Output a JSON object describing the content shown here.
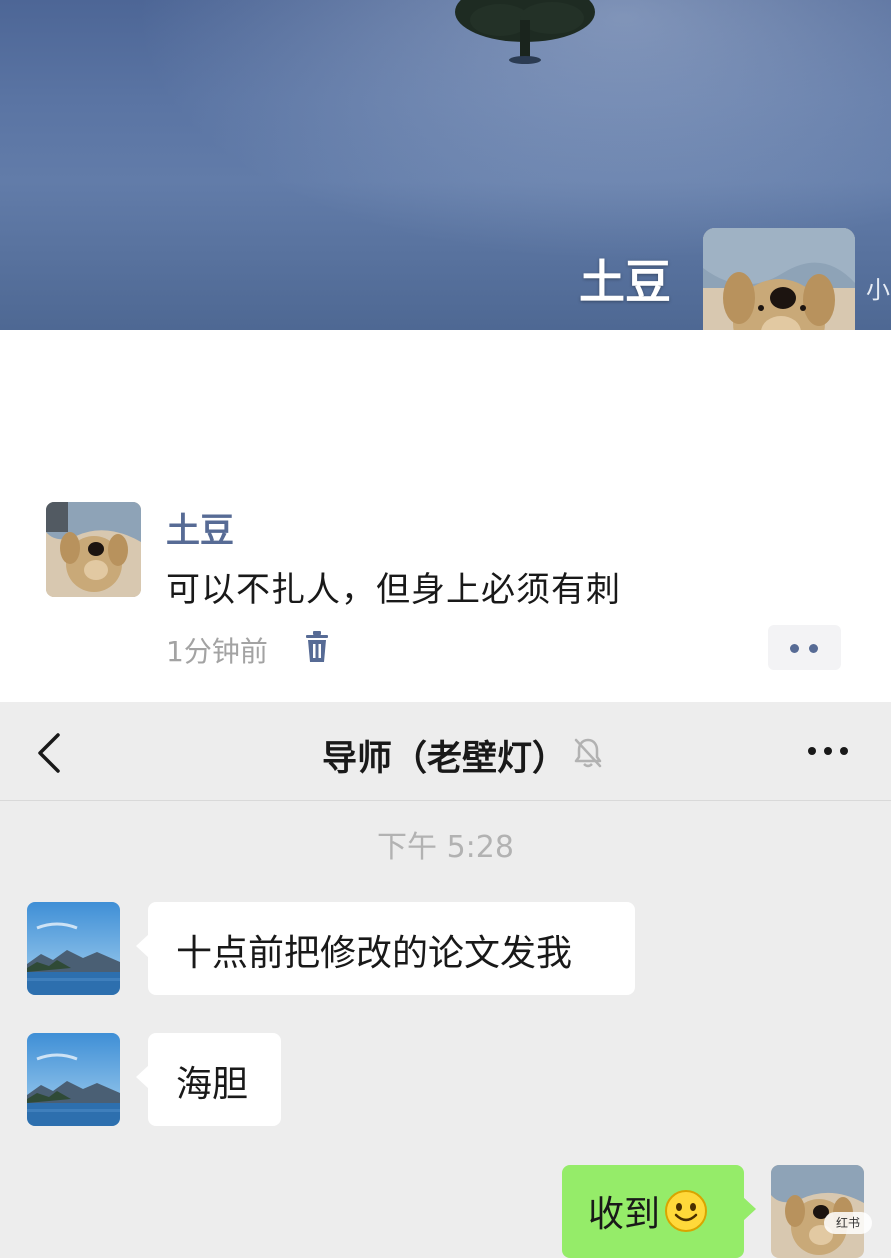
{
  "moments": {
    "cover_name": "土豆",
    "cover_hint": "小",
    "post": {
      "author": "土豆",
      "text": "可以不扎人，但身上必须有刺",
      "time": "1分钟前"
    }
  },
  "chat": {
    "title": "导师（老壁灯）",
    "time_divider": "下午 5:28",
    "messages": [
      {
        "side": "left",
        "text": "十点前把修改的论文发我"
      },
      {
        "side": "left",
        "text": "海胆"
      },
      {
        "side": "right",
        "text": "收到",
        "emoji": "smile-emoji"
      }
    ]
  },
  "icons": {
    "back": "chevron-left-icon",
    "mute": "bell-off-icon",
    "more": "more-dots-icon",
    "delete": "trash-icon"
  },
  "colors": {
    "link_name": "#576b95",
    "sent_bubble": "#95ec69",
    "received_bubble": "#ffffff",
    "chat_background": "#ededed"
  },
  "watermark": "红书"
}
